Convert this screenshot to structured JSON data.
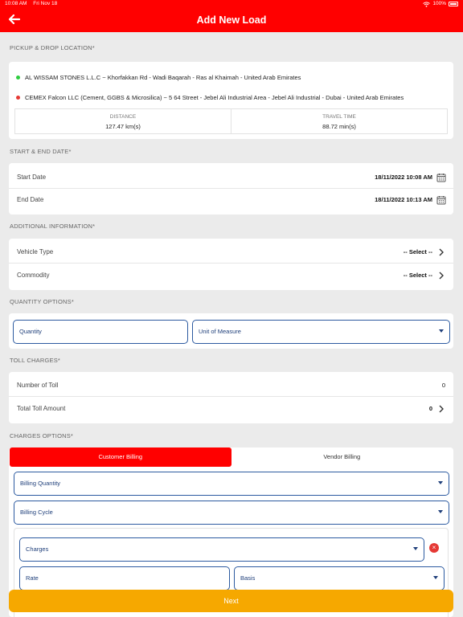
{
  "status_bar": {
    "time": "10:08 AM",
    "date": "Fri Nov 18",
    "battery": "100%"
  },
  "header": {
    "title": "Add New Load"
  },
  "pickup": {
    "section_label": "PICKUP & DROP LOCATION*",
    "pickup_address": "AL WISSAM STONES L.L.C ~ Khorfakkan Rd - Wadi Baqarah - Ras al Khaimah - United Arab Emirates",
    "drop_address": "CEMEX Falcon LLC (Cement, GGBS & Microsilica) ~ 5 64 Street - Jebel Ali Industrial Area - Jebel Ali Industrial - Dubai - United Arab Emirates",
    "distance_label": "DISTANCE",
    "distance_value": "127.47 km(s)",
    "travel_label": "TRAVEL TIME",
    "travel_value": "88.72 min(s)"
  },
  "dates": {
    "section_label": "START & END DATE*",
    "start_label": "Start Date",
    "start_value": "18/11/2022 10:08 AM",
    "end_label": "End Date",
    "end_value": "18/11/2022 10:13 AM"
  },
  "additional": {
    "section_label": "ADDITIONAL INFORMATION*",
    "vehicle_label": "Vehicle Type",
    "vehicle_value": "-- Select --",
    "commodity_label": "Commodity",
    "commodity_value": "-- Select --"
  },
  "quantity": {
    "section_label": "QUANTITY OPTIONS*",
    "quantity_placeholder": "Quantity",
    "unit_placeholder": "Unit of Measure"
  },
  "toll": {
    "section_label": "TOLL CHARGES*",
    "count_label": "Number of Toll",
    "count_value": "0",
    "amount_label": "Total Toll Amount",
    "amount_value": "0"
  },
  "charges": {
    "section_label": "CHARGES OPTIONS*",
    "tab_customer": "Customer Billing",
    "tab_vendor": "Vendor Billing",
    "billing_quantity": "Billing Quantity",
    "billing_cycle": "Billing Cycle",
    "charges_placeholder": "Charges",
    "rate_placeholder": "Rate",
    "basis_placeholder": "Basis"
  },
  "footer": {
    "next_label": "Next"
  },
  "colors": {
    "brand": "#ff0000",
    "accent": "#f6a800",
    "field_border": "#2c5aa0"
  }
}
